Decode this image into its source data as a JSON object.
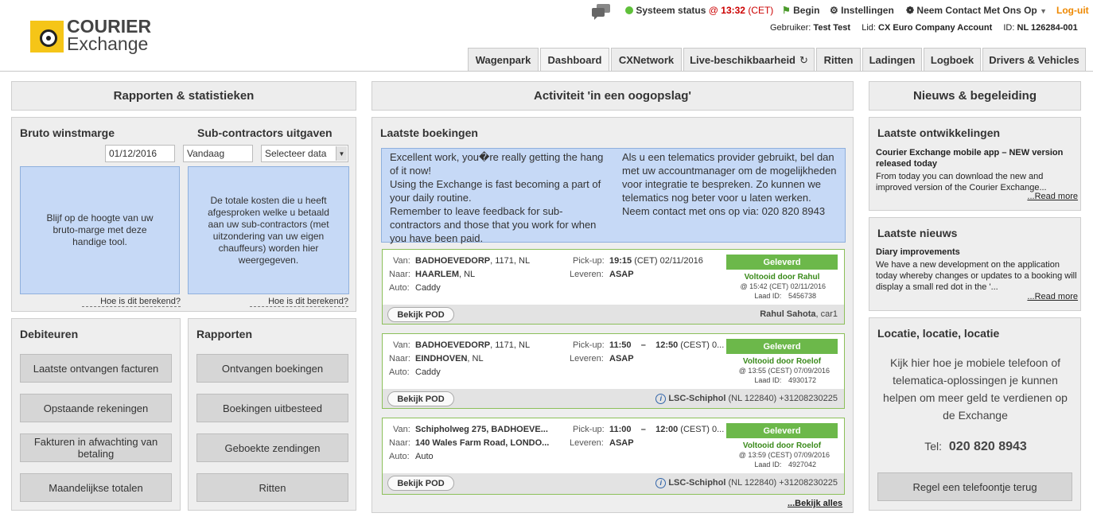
{
  "logo": {
    "line1": "COURIER",
    "line2": "Exchange"
  },
  "topbar": {
    "status_label": "Systeem status",
    "status_at": "@",
    "status_time": "13:32",
    "status_tz": "(CET)",
    "begin": "Begin",
    "settings": "Instellingen",
    "contact": "Neem Contact Met Ons Op",
    "logout": "Log-uit"
  },
  "user": {
    "user_label": "Gebruiker:",
    "user_value": "Test Test",
    "account_label": "Lid:",
    "account_value": "CX Euro Company Account",
    "id_label": "ID:",
    "id_value": "NL 126284-001"
  },
  "tabs": [
    "Wagenpark",
    "Dashboard",
    "CXNetwork",
    "Live-beschikbaarheid",
    "Ritten",
    "Ladingen",
    "Logboek",
    "Drivers & Vehicles"
  ],
  "left": {
    "header": "Rapporten & statistieken",
    "bruto_title": "Bruto winstmarge",
    "sub_title": "Sub-contractors uitgaven",
    "date_value": "01/12/2016",
    "today_value": "Vandaag",
    "select_label": "Selecteer data",
    "bruto_text": "Blijf op de hoogte van uw bruto-marge met deze handige tool.",
    "sub_text": "De totale kosten die u heeft afgesproken welke u betaald aan uw sub-contractors (met uitzondering van uw eigen chauffeurs) worden hier weergegeven.",
    "how_link": "Hoe is dit berekend?",
    "debiteuren_title": "Debiteuren",
    "debiteuren_buttons": [
      "Laatste ontvangen facturen",
      "Opstaande rekeningen",
      "Fakturen in afwachting van betaling",
      "Maandelijkse totalen"
    ],
    "rapporten_title": "Rapporten",
    "rapporten_buttons": [
      "Ontvangen boekingen",
      "Boekingen uitbesteed",
      "Geboekte zendingen",
      "Ritten"
    ]
  },
  "middle": {
    "header": "Activiteit 'in een oogopslag'",
    "bookings_title": "Laatste boekingen",
    "info_left": "Excellent work, you�re really getting the hang of it now!\nUsing the Exchange is fast becoming a part of your daily routine.\nRemember to leave feedback for sub-contractors and those that you work for when you have been paid.",
    "info_right": "Als u een telematics provider gebruikt, bel dan met uw accountmanager om de mogelijkheden voor integratie te bespreken. Zo kunnen we telematics nog beter voor u laten werken. Neem contact met ons op via: 020 820 8943",
    "labels": {
      "from": "Van:",
      "to": "Naar:",
      "vehicle": "Auto:",
      "pickup": "Pick-up:",
      "deliver": "Leveren:",
      "pod": "Bekijk POD",
      "load_id": "Laad ID:"
    },
    "bookings": [
      {
        "from_bold": "BADHOEVEDORP",
        "from_rest": ", 1171, NL",
        "to_bold": "HAARLEM",
        "to_rest": ", NL",
        "vehicle": "Caddy",
        "pickup_bold": "19:15",
        "pickup_rest": " (CET) 02/11/2016",
        "deliver": "ASAP",
        "status": "Geleverd",
        "completed": "Voltooid door Rahul",
        "completed_at": "@ 15:42 (CET) 02/11/2016",
        "load_id": "5456738",
        "footer_bold": "Rahul Sahota",
        "footer_rest": ", car1",
        "info_icon": false
      },
      {
        "from_bold": "BADHOEVEDORP",
        "from_rest": ", 1171, NL",
        "to_bold": "EINDHOVEN",
        "to_rest": ", NL",
        "vehicle": "Caddy",
        "pickup_bold": "11:50    –    12:50",
        "pickup_rest": " (CEST) 0...",
        "deliver": "ASAP",
        "status": "Geleverd",
        "completed": "Voltooid door Roelof",
        "completed_at": "@ 13:55 (CEST) 07/09/2016",
        "load_id": "4930172",
        "footer_bold": "LSC-Schiphol",
        "footer_rest": " (NL 122840) +31208230225",
        "info_icon": true
      },
      {
        "from_bold": "Schipholweg 275, BADHOEVE...",
        "from_rest": "",
        "to_bold": "140 Wales Farm Road, LONDO...",
        "to_rest": "",
        "vehicle": "Auto",
        "pickup_bold": "11:00    –    12:00",
        "pickup_rest": " (CEST) 0...",
        "deliver": "ASAP",
        "status": "Geleverd",
        "completed": "Voltooid door Roelof",
        "completed_at": "@ 13:59 (CEST) 07/09/2016",
        "load_id": "4927042",
        "footer_bold": "LSC-Schiphol",
        "footer_rest": " (NL 122840) +31208230225",
        "info_icon": true
      }
    ],
    "view_all": "...Bekijk alles"
  },
  "right": {
    "header": "Nieuws & begeleiding",
    "dev_title": "Laatste ontwikkelingen",
    "dev_headline": "Courier Exchange mobile app – NEW version released today",
    "dev_text": "From today you can download the new and improved version of the Courier Exchange...",
    "read_more": "...Read more",
    "news_title": "Laatste nieuws",
    "news_headline": "Diary improvements",
    "news_text": "We have a new development on the application today whereby changes or updates to a booking will display a small red dot in the '...",
    "loc_title": "Locatie, locatie, locatie",
    "loc_text": "Kijk hier hoe je mobiele telefoon of telematica-oplossingen je kunnen helpen om meer geld te verdienen op de Exchange",
    "tel_label": "Tel:",
    "tel_value": "020 820 8943",
    "callback_button": "Regel een telefoontje terug"
  },
  "colors": {
    "accent_green": "#6cb84a",
    "logout_orange": "#ee8800",
    "status_red": "#cc0000",
    "info_blue": "#c6d9f6"
  }
}
